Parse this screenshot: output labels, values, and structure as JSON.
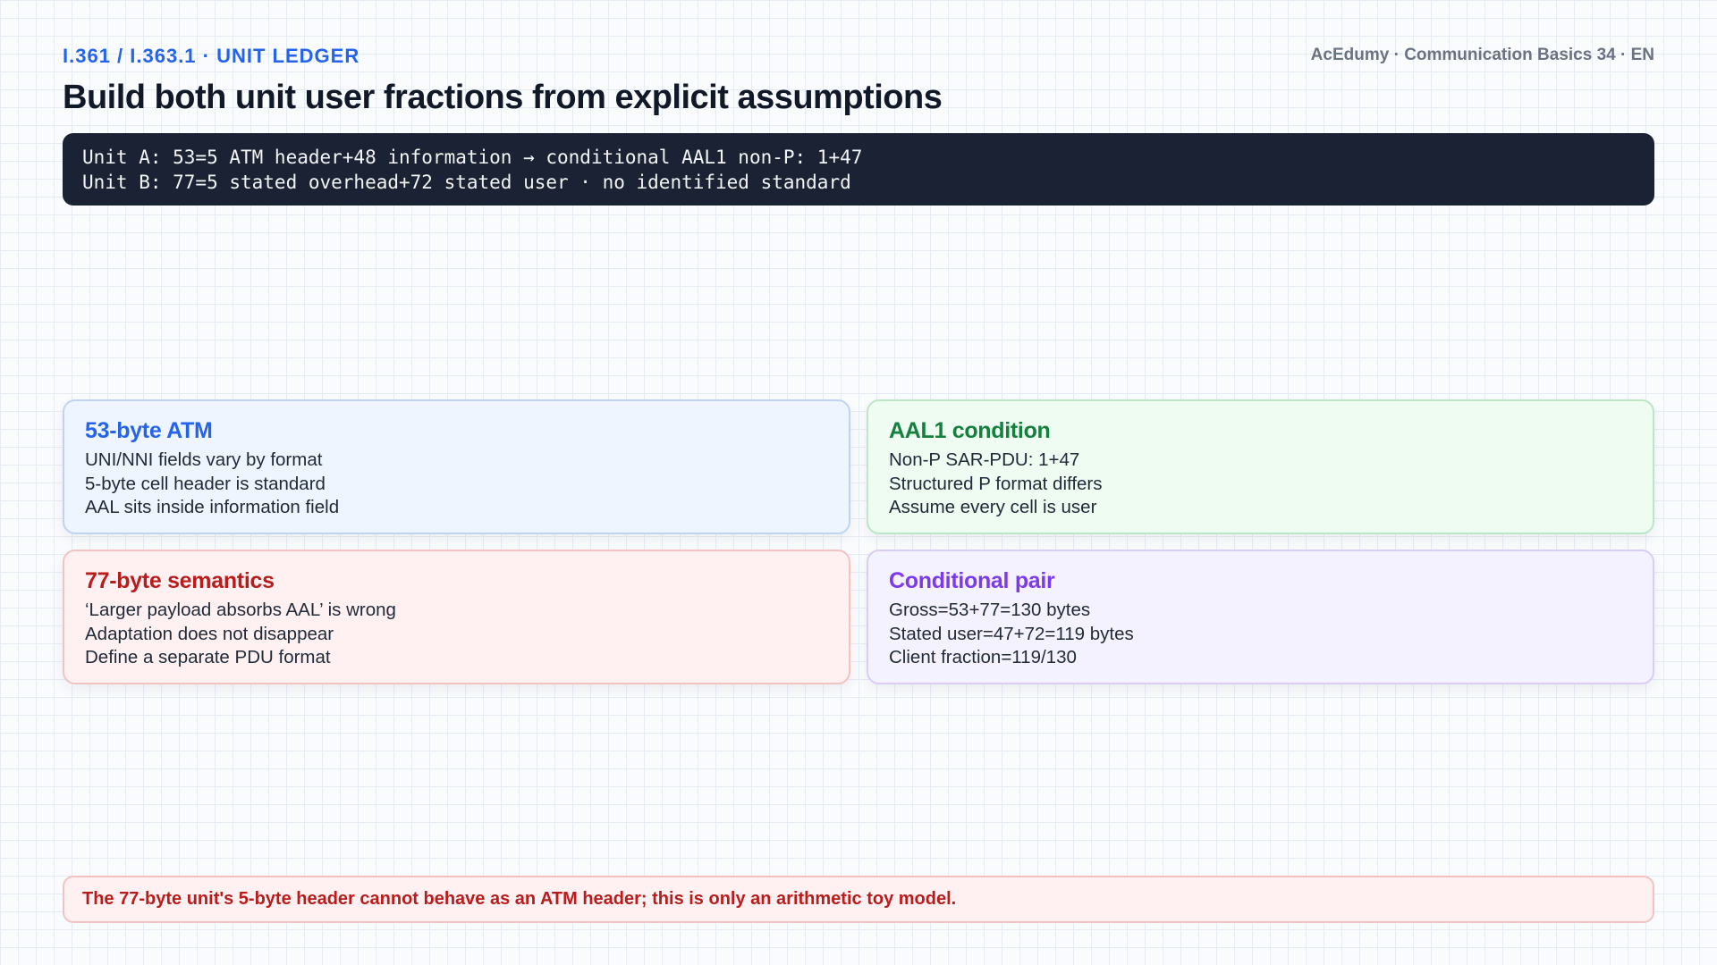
{
  "header": {
    "kicker": "I.361 / I.363.1 · UNIT LEDGER",
    "brand": "AcEdumy · Communication Basics 34 · EN",
    "title": "Build both unit user fractions from explicit assumptions"
  },
  "code_block": {
    "line1": "Unit A: 53=5 ATM header+48 information → conditional AAL1 non-P: 1+47",
    "line2": "Unit B: 77=5 stated overhead+72 stated user · no identified standard"
  },
  "cards": [
    {
      "title": "53-byte ATM",
      "lines": [
        "UNI/NNI fields vary by format",
        "5-byte cell header is standard",
        "AAL sits inside information field"
      ]
    },
    {
      "title": "AAL1 condition",
      "lines": [
        "Non-P SAR-PDU: 1+47",
        "Structured P format differs",
        "Assume every cell is user"
      ]
    },
    {
      "title": "77-byte semantics",
      "lines": [
        "‘Larger payload absorbs AAL’ is wrong",
        "Adaptation does not disappear",
        "Define a separate PDU format"
      ]
    },
    {
      "title": "Conditional pair",
      "lines": [
        "Gross=53+77=130 bytes",
        "Stated user=47+72=119 bytes",
        "Client fraction=119/130"
      ]
    }
  ],
  "note": "The 77-byte unit's 5-byte header cannot behave as an ATM header; this is only an arithmetic toy model.",
  "colors": {
    "blue": "#2563eb",
    "green": "#15803d",
    "red": "#b91c1c",
    "purple": "#7c3aed",
    "code_bg": "#1a2233"
  }
}
